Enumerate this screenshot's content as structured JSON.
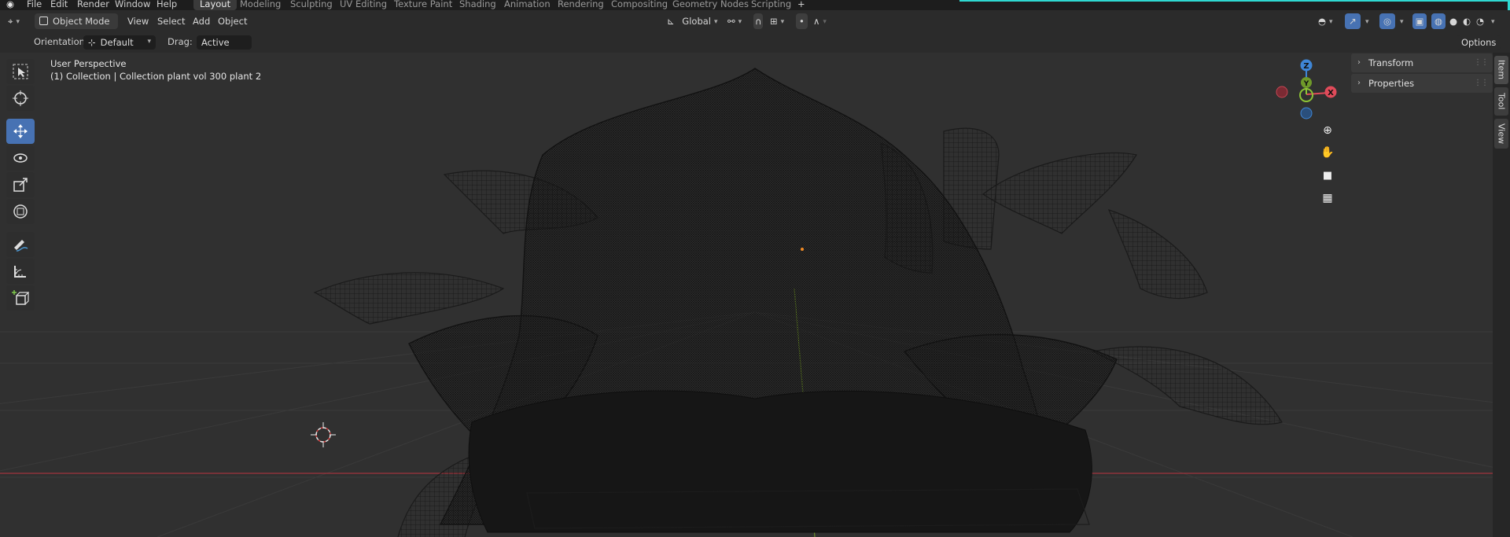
{
  "menubar": {
    "items": [
      "File",
      "Edit",
      "Render",
      "Window",
      "Help"
    ],
    "workspaces": [
      "Layout",
      "Modeling",
      "Sculpting",
      "UV Editing",
      "Texture Paint",
      "Shading",
      "Animation",
      "Rendering",
      "Compositing",
      "Geometry Nodes",
      "Scripting"
    ],
    "active_workspace": "Layout",
    "add_tab": "+"
  },
  "header": {
    "mode": "Object Mode",
    "menus": [
      "View",
      "Select",
      "Add",
      "Object"
    ],
    "transform_orientation": "Global",
    "options": "Options"
  },
  "toolsettings": {
    "orientation_label": "Orientation:",
    "orientation_value": "Default",
    "drag_label": "Drag:",
    "drag_value": "Active Tool"
  },
  "viewport": {
    "view_name": "User Perspective",
    "collection_info": "(1) Collection | Collection plant vol 300 plant 2",
    "gizmo_axes": [
      "Z",
      "Y",
      "X"
    ]
  },
  "npanel": {
    "sections": [
      "Transform",
      "Properties"
    ],
    "tabs": [
      "Item",
      "Tool",
      "View"
    ]
  },
  "tools": [
    "select-box",
    "cursor",
    "move",
    "rotate",
    "scale",
    "transform",
    "annotate",
    "measure",
    "add-cube"
  ],
  "colors": {
    "accent": "#4772b3",
    "x_axis": "#e04b5a",
    "y_axis": "#8dc435",
    "z_axis": "#3f86d6",
    "teal": "#2fd8d0"
  }
}
